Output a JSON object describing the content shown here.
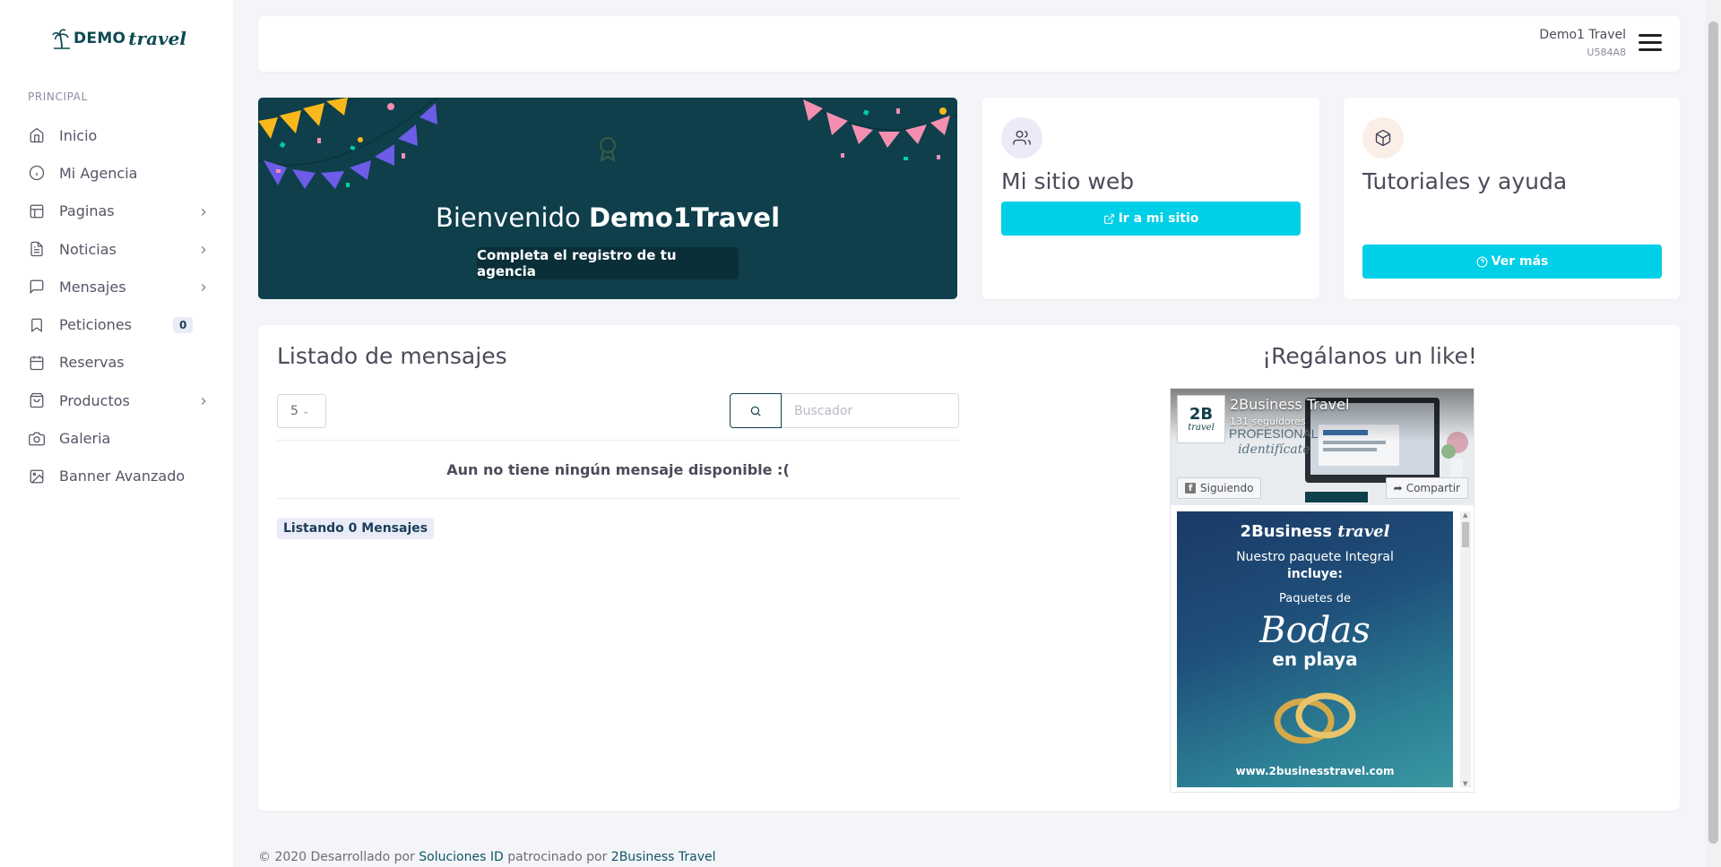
{
  "brand": {
    "name": "DEMO",
    "script": "travel",
    "color": "#0f4a52"
  },
  "sidebar": {
    "section_label": "PRINCIPAL",
    "items": [
      {
        "label": "Inicio",
        "icon": "home-icon",
        "has_chevron": false
      },
      {
        "label": "Mi Agencia",
        "icon": "info-icon",
        "has_chevron": false
      },
      {
        "label": "Paginas",
        "icon": "layout-icon",
        "has_chevron": true
      },
      {
        "label": "Noticias",
        "icon": "file-text-icon",
        "has_chevron": true
      },
      {
        "label": "Mensajes",
        "icon": "message-square-icon",
        "has_chevron": true
      },
      {
        "label": "Peticiones",
        "icon": "bookmark-icon",
        "has_chevron": false,
        "badge": "0"
      },
      {
        "label": "Reservas",
        "icon": "calendar-icon",
        "has_chevron": false
      },
      {
        "label": "Productos",
        "icon": "shopping-bag-icon",
        "has_chevron": true
      },
      {
        "label": "Galeria",
        "icon": "camera-icon",
        "has_chevron": false
      },
      {
        "label": "Banner Avanzado",
        "icon": "image-icon",
        "has_chevron": false
      }
    ]
  },
  "header": {
    "user_name": "Demo1 Travel",
    "user_code": "U584A8"
  },
  "welcome": {
    "greeting": "Bienvenido",
    "agency": "Demo1Travel",
    "button": "Completa el registro de tu agencia",
    "bg_color": "#0e3f4b"
  },
  "cards": {
    "site": {
      "title": "Mi sitio web",
      "button": "Ir a mi sitio",
      "icon": "users-icon"
    },
    "help": {
      "title": "Tutoriales y ayuda",
      "button": "Ver más",
      "icon": "box-icon"
    },
    "accent": "#00cfe8"
  },
  "messages": {
    "title": "Listado de mensajes",
    "per_page": "5",
    "search_placeholder": "Buscador",
    "empty_text": "Aun no tiene ningún mensaje disponible :(",
    "count_label": "Listando 0 Mensajes"
  },
  "like": {
    "title": "¡Regálanos un like!",
    "page_name": "2Business Travel",
    "followers": "131 seguidores",
    "follow_button": "Siguiendo",
    "share_button": "Compartir",
    "post": {
      "brand": "2Business",
      "brand_script": "travel",
      "line1": "Nuestro paquete Integral",
      "line2": "incluye:",
      "line3": "Paquetes de",
      "script": "Bodas",
      "line4": "en playa",
      "url": "www.2businesstravel.com"
    }
  },
  "footer": {
    "prefix": "© 2020 Desarrollado por",
    "link1": "Soluciones ID",
    "middle": "patrocinado por",
    "link2": "2Business Travel"
  }
}
